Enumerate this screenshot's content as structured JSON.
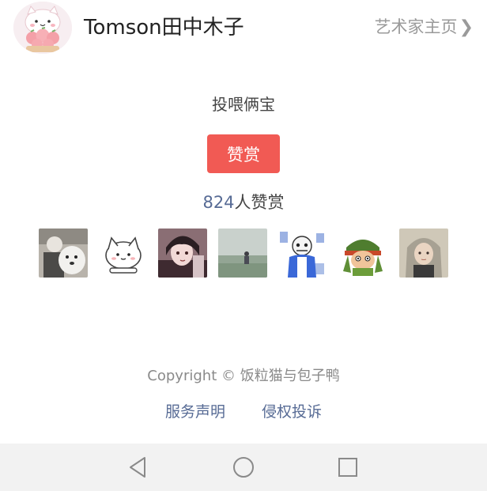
{
  "header": {
    "author_name": "Tomson田中木子",
    "artist_link": "艺术家主页",
    "chevron": "❯",
    "avatar_icon": "cat-holding-peaches-avatar"
  },
  "reward": {
    "prompt": "投喂俩宝",
    "button_label": "赞赏",
    "count_number": "824",
    "count_suffix": "人赞赏",
    "accent_color": "#f15a54",
    "link_color": "#576b95"
  },
  "supporters": [
    {
      "name": "supporter-avatar-1"
    },
    {
      "name": "supporter-avatar-2"
    },
    {
      "name": "supporter-avatar-3"
    },
    {
      "name": "supporter-avatar-4"
    },
    {
      "name": "supporter-avatar-5"
    },
    {
      "name": "supporter-avatar-6"
    },
    {
      "name": "supporter-avatar-7"
    }
  ],
  "footer": {
    "copyright": "Copyright © 饭粒猫与包子鸭",
    "links": {
      "service": "服务声明",
      "complaint": "侵权投诉"
    }
  },
  "navbar": {
    "icons": [
      "back-triangle-icon",
      "home-circle-icon",
      "recents-square-icon"
    ]
  }
}
